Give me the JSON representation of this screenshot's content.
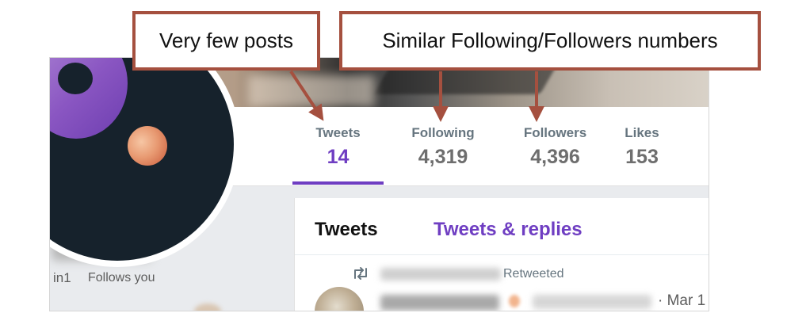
{
  "stats": [
    {
      "label": "Tweets",
      "value": "14",
      "active": true
    },
    {
      "label": "Following",
      "value": "4,319",
      "active": false
    },
    {
      "label": "Followers",
      "value": "4,396",
      "active": false
    },
    {
      "label": "Likes",
      "value": "153",
      "active": false
    }
  ],
  "profile": {
    "handle_fragment": "in1",
    "follows_you": "Follows you"
  },
  "timeline": {
    "tabs": [
      {
        "label": "Tweets",
        "active": false
      },
      {
        "label": "Tweets & replies",
        "active": true
      }
    ],
    "retweeted_label": "Retweeted",
    "tweet_date": "· Mar 1"
  },
  "annotations": {
    "few_posts": "Very few posts",
    "similar_numbers": "Similar Following/Followers numbers"
  },
  "colors": {
    "accent": "#6f3ec2",
    "callout_border": "#a5503f",
    "muted_text": "#66757f"
  },
  "icons": {
    "retweet": "retweet-icon"
  }
}
